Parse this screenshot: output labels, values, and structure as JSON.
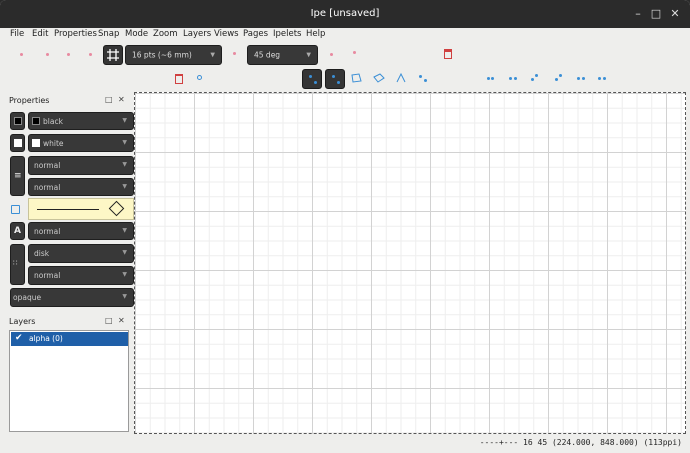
{
  "window": {
    "title": "Ipe [unsaved]"
  },
  "menubar": [
    "File",
    "Edit",
    "Properties",
    "Snap",
    "Mode",
    "Zoom",
    "Layers",
    "Views",
    "Pages",
    "Ipelets",
    "Help"
  ],
  "toolbar": {
    "grid_size": "16 pts (~6 mm)",
    "angle": "45 deg"
  },
  "properties_panel": {
    "title": "Properties",
    "stroke_color": "black",
    "fill_color": "white",
    "pen": "normal",
    "dash": "normal",
    "text_size": "normal",
    "symbol": "disk",
    "symbol_size": "normal",
    "opacity": "opaque"
  },
  "layers_panel": {
    "title": "Layers",
    "layers": [
      {
        "name": "alpha (0)",
        "checked": true
      }
    ]
  },
  "statusbar": {
    "text": "----+--- 16 45 (224.000, 848.000) (113ppi)"
  },
  "colors": {
    "titlebar": "#2b2b2b",
    "selection": "#1f5fa8",
    "snap_dot": "#3b8fd6",
    "mark_dot": "#e88aa0"
  }
}
